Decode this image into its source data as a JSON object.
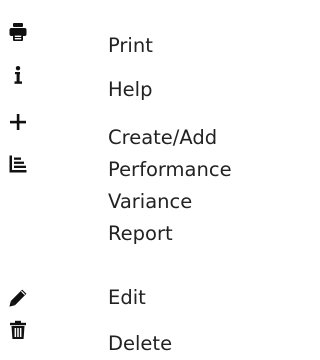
{
  "legend": {
    "items": [
      {
        "icon": "print-icon",
        "label": "Print"
      },
      {
        "icon": "help-icon",
        "label": "Help"
      },
      {
        "icon": "plus-icon",
        "label": "Create/Add"
      },
      {
        "icon": "bar-chart-icon",
        "label": "Performance\nVariance\nReport"
      },
      {
        "icon": "pencil-icon",
        "label": "Edit"
      },
      {
        "icon": "trash-icon",
        "label": "Delete"
      }
    ]
  },
  "colors": {
    "icon": "#111111",
    "text": "#222222",
    "background": "#ffffff"
  }
}
